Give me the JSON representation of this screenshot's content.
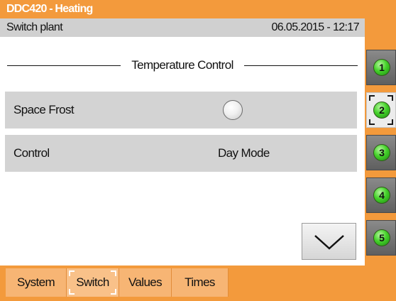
{
  "window": {
    "title": "DDC420 - Heating"
  },
  "subheader": {
    "page_name": "Switch plant",
    "datetime": "06.05.2015 - 12:17"
  },
  "section": {
    "title": "Temperature Control"
  },
  "rows": [
    {
      "label": "Space Frost",
      "control": "radio",
      "checked": false
    },
    {
      "label": "Control",
      "value": "Day Mode"
    }
  ],
  "side_buttons": [
    {
      "label": "1",
      "active": false
    },
    {
      "label": "2",
      "active": true
    },
    {
      "label": "3",
      "active": false
    },
    {
      "label": "4",
      "active": false
    },
    {
      "label": "5",
      "active": false
    }
  ],
  "tabs": [
    {
      "label": "System",
      "active": false
    },
    {
      "label": "Switch",
      "active": true
    },
    {
      "label": "Values",
      "active": false
    },
    {
      "label": "Times",
      "active": false
    }
  ],
  "icons": {
    "scroll_down": "chevron-down-icon"
  },
  "colors": {
    "frame": "#f39a3c",
    "tab": "#f7b574",
    "row": "#d3d3d3",
    "indicator": "#45d22a"
  }
}
